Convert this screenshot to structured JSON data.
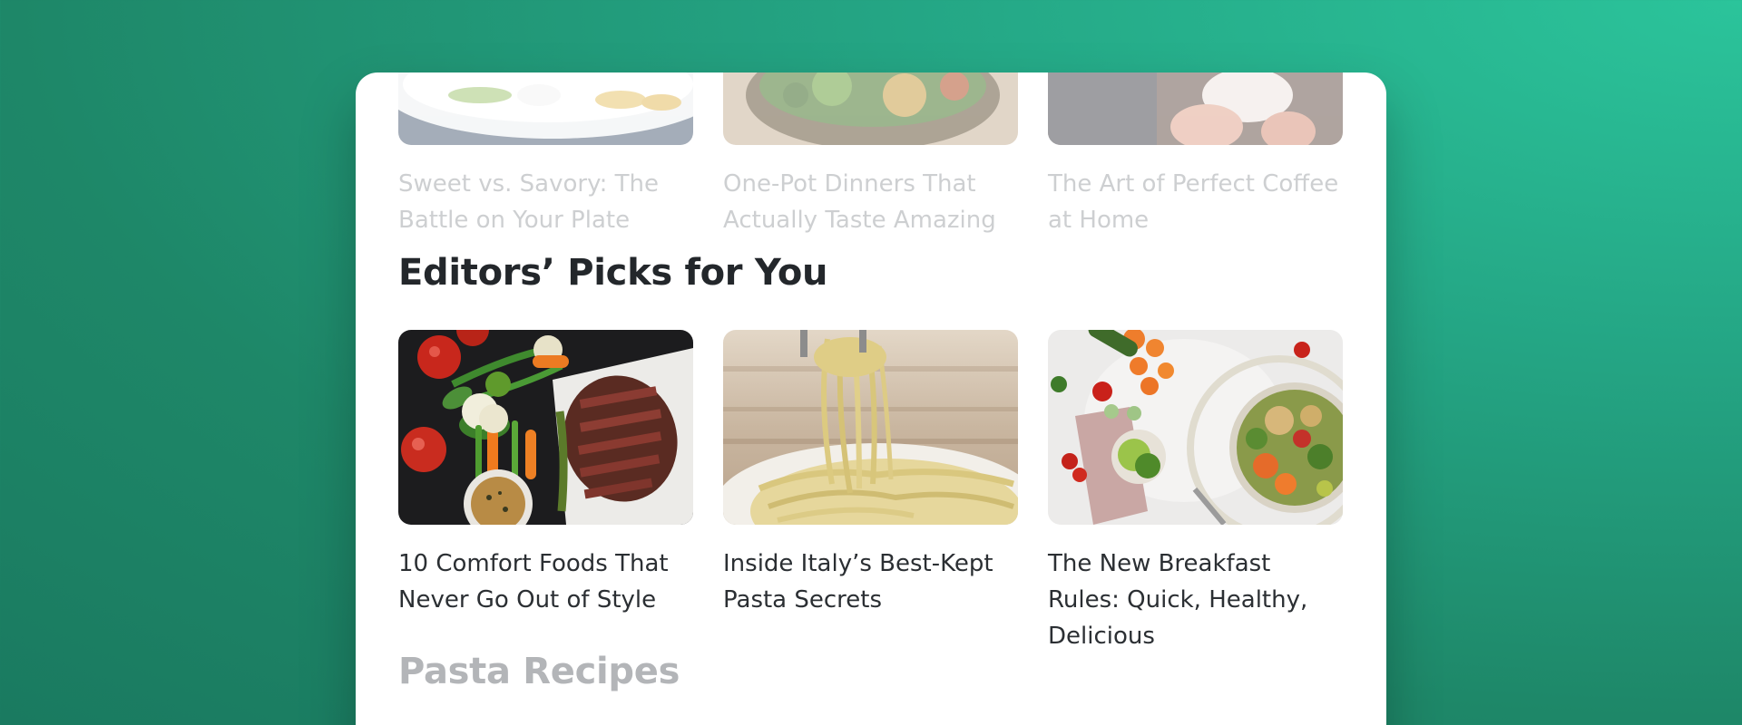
{
  "top_row": [
    {
      "title": "Sweet vs. Savory: The Battle on Your Plate"
    },
    {
      "title": "One-Pot Dinners That Actually Taste Amazing"
    },
    {
      "title": "The Art of Perfect Coffee at Home"
    }
  ],
  "section": {
    "heading": "Editors’ Picks for You"
  },
  "picks": [
    {
      "title": "10 Comfort Foods That Never Go Out of Style",
      "image": "steak-vegetables-image"
    },
    {
      "title": "Inside Italy’s Best-Kept Pasta Secrets",
      "image": "pasta-fork-image"
    },
    {
      "title": "The New Breakfast Rules: Quick, Healthy, Delicious",
      "image": "healthy-bowl-image"
    }
  ],
  "next_section": {
    "heading": "Pasta Recipes"
  }
}
